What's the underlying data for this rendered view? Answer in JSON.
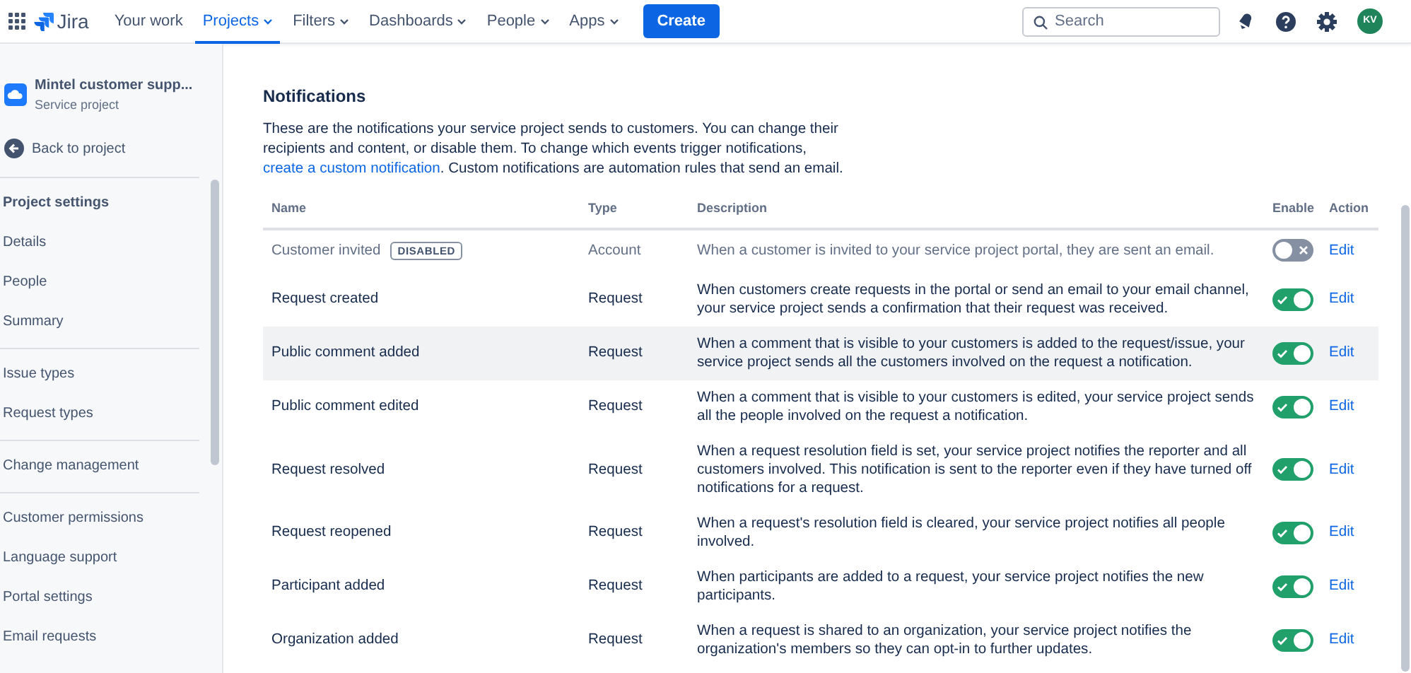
{
  "topnav": {
    "product": "Jira",
    "items": [
      {
        "label": "Your work",
        "dropdown": false,
        "selected": false
      },
      {
        "label": "Projects",
        "dropdown": true,
        "selected": true
      },
      {
        "label": "Filters",
        "dropdown": true,
        "selected": false
      },
      {
        "label": "Dashboards",
        "dropdown": true,
        "selected": false
      },
      {
        "label": "People",
        "dropdown": true,
        "selected": false
      },
      {
        "label": "Apps",
        "dropdown": true,
        "selected": false
      }
    ],
    "create": "Create",
    "search": {
      "placeholder": "Search"
    },
    "avatar": "KV"
  },
  "sidebar": {
    "project": {
      "name": "Mintel customer supp...",
      "type": "Service project"
    },
    "back": "Back to project",
    "heading": "Project settings",
    "groups": [
      [
        "Details",
        "People",
        "Summary"
      ],
      [
        "Issue types",
        "Request types"
      ],
      [
        "Change management"
      ],
      [
        "Customer permissions",
        "Language support",
        "Portal settings",
        "Email requests"
      ]
    ]
  },
  "notifications": {
    "title": "Notifications",
    "intro": [
      "These are the notifications your service project sends to customers. You can change their recipients and content, or disable them. To change which events trigger notifications, ",
      "create a custom notification",
      ". Custom notifications are automation rules that send an email."
    ],
    "table": {
      "columns": [
        "Name",
        "Type",
        "Description",
        "Enable",
        "Action"
      ],
      "rows": [
        {
          "name": "Customer invited",
          "badge": "DISABLED",
          "type": "Account",
          "description": "When a customer is invited to your service project portal, they are sent an email.",
          "enabled": false,
          "action": "Edit",
          "selected": false
        },
        {
          "name": "Request created",
          "type": "Request",
          "description": "When customers create requests in the portal or send an email to your email channel, your service project sends a confirmation that their request was received.",
          "enabled": true,
          "action": "Edit",
          "selected": false
        },
        {
          "name": "Public comment added",
          "type": "Request",
          "description": "When a comment that is visible to your customers is added to the request/issue, your service project sends all the customers involved on the request a notification.",
          "enabled": true,
          "action": "Edit",
          "selected": true
        },
        {
          "name": "Public comment edited",
          "type": "Request",
          "description": "When a comment that is visible to your customers is edited, your service project sends all the people involved on the request a notification.",
          "enabled": true,
          "action": "Edit",
          "selected": false
        },
        {
          "name": "Request resolved",
          "type": "Request",
          "description": "When a request resolution field is set, your service project notifies the reporter and all customers involved. This notification is sent to the reporter even if they have turned off notifications for a request.",
          "enabled": true,
          "action": "Edit",
          "selected": false
        },
        {
          "name": "Request reopened",
          "type": "Request",
          "description": "When a request's resolution field is cleared, your service project notifies all people involved.",
          "enabled": true,
          "action": "Edit",
          "selected": false
        },
        {
          "name": "Participant added",
          "type": "Request",
          "description": "When participants are added to a request, your service project notifies the new participants.",
          "enabled": true,
          "action": "Edit",
          "selected": false
        },
        {
          "name": "Organization added",
          "type": "Request",
          "description": "When a request is shared to an organization, your service project notifies the organization's members so they can opt-in to further updates.",
          "enabled": true,
          "action": "Edit",
          "selected": false
        }
      ]
    }
  }
}
